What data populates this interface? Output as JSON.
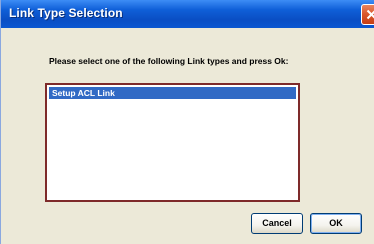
{
  "window": {
    "title": "Link Type Selection"
  },
  "prompt": "Please select one of the following Link types and press Ok:",
  "link_types": {
    "items": [
      "Setup ACL Link"
    ],
    "selected_index": 0
  },
  "buttons": {
    "cancel_label": "Cancel",
    "ok_label": "OK"
  },
  "colors": {
    "titlebar": "#0b57d1",
    "selection": "#316ac5",
    "listbox_border": "#7e2a2a",
    "dialog_background": "#ece9d8",
    "close_button": "#d9552b"
  }
}
